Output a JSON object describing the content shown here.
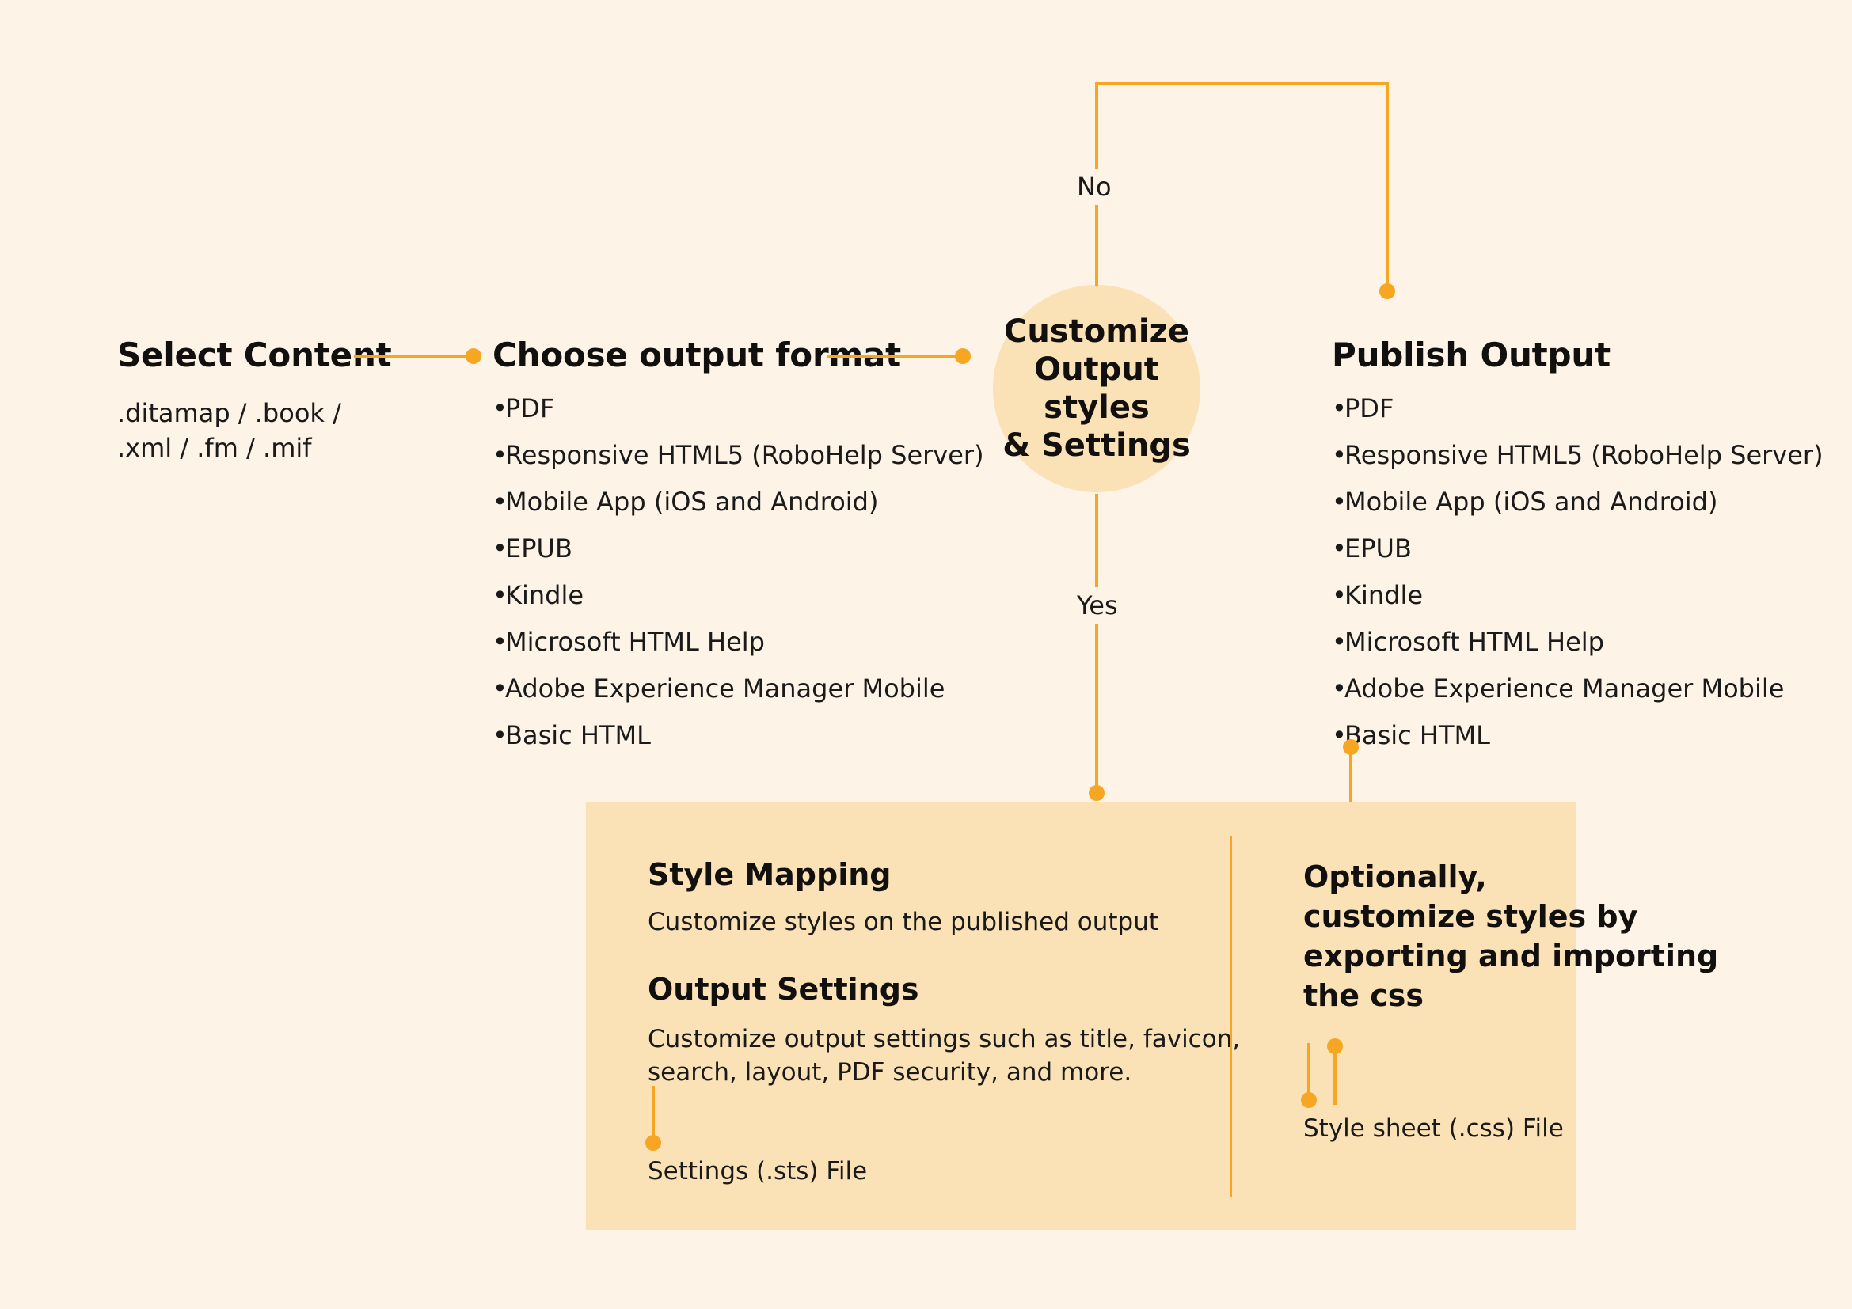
{
  "colors": {
    "background": "#FDF3E7",
    "accent": "#F6A623",
    "panel": "#FBE2B6",
    "circle": "#FBE2B6",
    "text": "#1A1A1A",
    "heading": "#12100E"
  },
  "flow": {
    "select_content": {
      "title": "Select Content",
      "formats": ".ditamap / .book /\n.xml / .fm / .mif"
    },
    "choose_output_format": {
      "title": "Choose output format",
      "items": [
        "PDF",
        "Responsive HTML5 (RoboHelp Server)",
        "Mobile App (iOS and Android)",
        "EPUB",
        "Kindle",
        "Microsoft HTML Help",
        "Adobe Experience Manager Mobile",
        "Basic HTML"
      ]
    },
    "decision": {
      "title": "Customize\nOutput styles\n& Settings",
      "branch_no": "No",
      "branch_yes": "Yes"
    },
    "publish_output": {
      "title": "Publish Output",
      "items": [
        "PDF",
        "Responsive HTML5 (RoboHelp Server)",
        "Mobile App (iOS and Android)",
        "EPUB",
        "Kindle",
        "Microsoft HTML Help",
        "Adobe Experience Manager Mobile",
        "Basic HTML"
      ]
    }
  },
  "panel": {
    "left": {
      "style_mapping_heading": "Style Mapping",
      "style_mapping_body": "Customize styles on the published output",
      "output_settings_heading": "Output Settings",
      "output_settings_body": "Customize output settings such as title, favicon,\nsearch, layout, PDF security, and more.",
      "output_file": "Settings (.sts) File"
    },
    "right": {
      "heading": "Optionally,\ncustomize styles by\nexporting and importing\nthe css",
      "output_file": "Style sheet (.css) File"
    }
  }
}
